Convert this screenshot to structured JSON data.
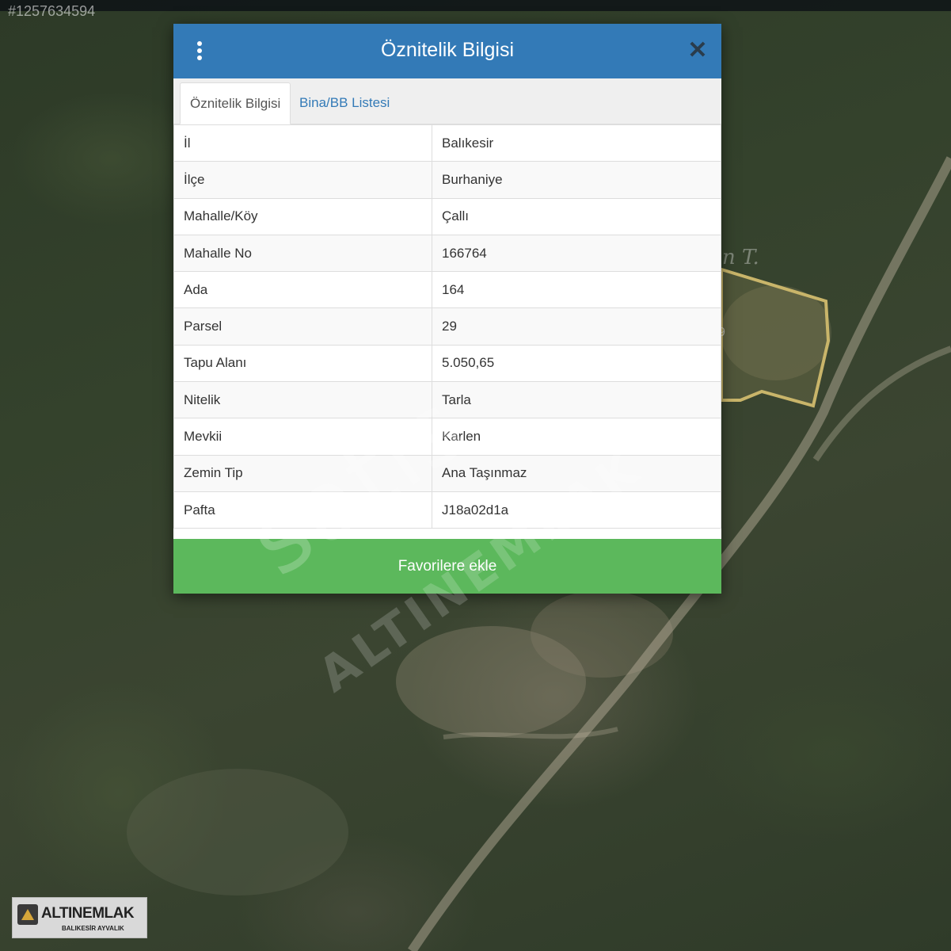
{
  "listing_id": "#1257634594",
  "modal": {
    "title": "Öznitelik Bilgisi",
    "tabs": [
      {
        "label": "Öznitelik Bilgisi",
        "active": true
      },
      {
        "label": "Bina/BB Listesi",
        "active": false
      }
    ],
    "rows": [
      {
        "key": "İl",
        "value": "Balıkesir"
      },
      {
        "key": "İlçe",
        "value": "Burhaniye"
      },
      {
        "key": "Mahalle/Köy",
        "value": "Çallı"
      },
      {
        "key": "Mahalle No",
        "value": "166764"
      },
      {
        "key": "Ada",
        "value": "164"
      },
      {
        "key": "Parsel",
        "value": "29"
      },
      {
        "key": "Tapu Alanı",
        "value": "5.050,65"
      },
      {
        "key": "Nitelik",
        "value": "Tarla"
      },
      {
        "key": "Mevkii",
        "value": "Karlen"
      },
      {
        "key": "Zemin Tip",
        "value": "Ana Taşınmaz"
      },
      {
        "key": "Pafta",
        "value": "J18a02d1a"
      }
    ],
    "favorite_button": "Favorilere ekle",
    "colors": {
      "header": "#337ab7",
      "button": "#5cb85c",
      "tab_link": "#337ab7"
    }
  },
  "watermark": {
    "line1": "satis",
    "line2": "ALTINEMLAK"
  },
  "logo": {
    "name": "ALTINEMLAK",
    "subtitle": "BALIKESİR AYVALIK"
  },
  "map": {
    "parcel_label_fragment": "n T.",
    "parcel_number_fragment": "9"
  }
}
